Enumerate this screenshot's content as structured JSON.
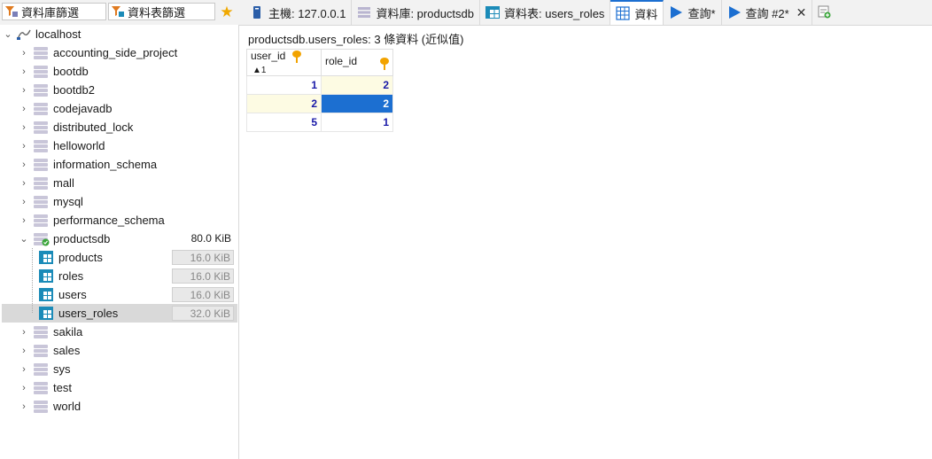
{
  "toolbar": {
    "db_filter_placeholder": "資料庫篩選",
    "table_filter_placeholder": "資料表篩選"
  },
  "tabs": [
    {
      "label": "主機: 127.0.0.1",
      "icon": "server-icon"
    },
    {
      "label": "資料庫: productsdb",
      "icon": "database-icon"
    },
    {
      "label": "資料表: users_roles",
      "icon": "table-icon"
    },
    {
      "label": "資料",
      "icon": "grid-icon",
      "active": true
    },
    {
      "label": "查詢*",
      "icon": "play-icon"
    },
    {
      "label": "查詢 #2*",
      "icon": "play-icon",
      "closable": true,
      "close": "✕"
    }
  ],
  "tree": {
    "root": "localhost",
    "databases": [
      "accounting_side_project",
      "bootdb",
      "bootdb2",
      "codejavadb",
      "distributed_lock",
      "helloworld",
      "information_schema",
      "mall",
      "mysql",
      "performance_schema"
    ],
    "expanded_db": {
      "name": "productsdb",
      "size": "80.0 KiB"
    },
    "tables": [
      {
        "name": "products",
        "size": "16.0 KiB"
      },
      {
        "name": "roles",
        "size": "16.0 KiB"
      },
      {
        "name": "users",
        "size": "16.0 KiB"
      },
      {
        "name": "users_roles",
        "size": "32.0 KiB"
      }
    ],
    "databases_after": [
      "sakila",
      "sales",
      "sys",
      "test",
      "world"
    ]
  },
  "main": {
    "info": "productsdb.users_roles: 3 條資料 (近似值)",
    "columns": [
      {
        "name": "user_id",
        "sort": "▲1"
      },
      {
        "name": "role_id"
      }
    ],
    "rows": [
      [
        "1",
        "2"
      ],
      [
        "2",
        "2"
      ],
      [
        "5",
        "1"
      ]
    ]
  }
}
